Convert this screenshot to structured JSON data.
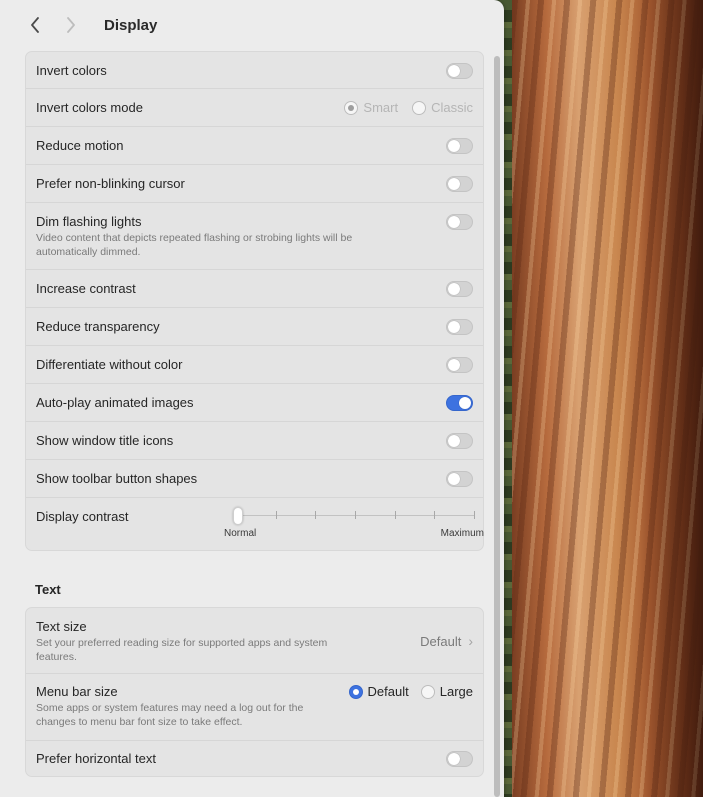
{
  "window": {
    "title": "Display",
    "back_icon": "chevron-left-icon",
    "forward_icon": "chevron-right-icon"
  },
  "display_group": {
    "rows": [
      {
        "label": "Invert colors",
        "toggle": false
      },
      {
        "label": "Invert colors mode",
        "options": [
          "Smart",
          "Classic"
        ],
        "selected": "Smart",
        "disabled": true
      },
      {
        "label": "Reduce motion",
        "toggle": false
      },
      {
        "label": "Prefer non-blinking cursor",
        "toggle": false
      },
      {
        "label": "Dim flashing lights",
        "description": "Video content that depicts repeated flashing or strobing lights will be automatically dimmed.",
        "toggle": false
      },
      {
        "label": "Increase contrast",
        "toggle": false
      },
      {
        "label": "Reduce transparency",
        "toggle": false
      },
      {
        "label": "Differentiate without color",
        "toggle": false
      },
      {
        "label": "Auto-play animated images",
        "toggle": true
      },
      {
        "label": "Show window title icons",
        "toggle": false
      },
      {
        "label": "Show toolbar button shapes",
        "toggle": false
      }
    ],
    "contrast": {
      "label": "Display contrast",
      "min_label": "Normal",
      "max_label": "Maximum",
      "ticks": 7,
      "value": 0
    }
  },
  "text_section": {
    "heading": "Text",
    "text_size": {
      "label": "Text size",
      "description": "Set your preferred reading size for supported apps and system features.",
      "value": "Default"
    },
    "menu_bar_size": {
      "label": "Menu bar size",
      "description": "Some apps or system features may need a log out for the changes to menu bar font size to take effect.",
      "options": [
        "Default",
        "Large"
      ],
      "selected": "Default"
    },
    "prefer_horizontal": {
      "label": "Prefer horizontal text",
      "toggle": false
    }
  },
  "colors": {
    "accent": "#3d72e0",
    "panel": "#ececec",
    "group": "#e4e4e4"
  }
}
